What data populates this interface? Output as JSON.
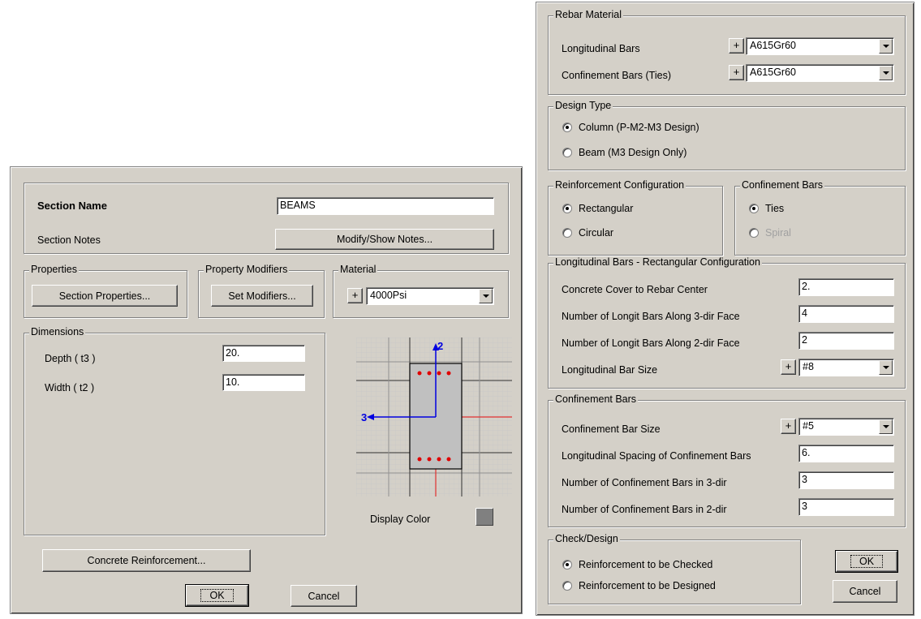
{
  "left": {
    "section_name_label": "Section Name",
    "section_name_value": "BEAMS",
    "section_notes_label": "Section Notes",
    "modify_notes_button": "Modify/Show Notes...",
    "properties_legend": "Properties",
    "section_properties_button": "Section Properties...",
    "modifiers_legend": "Property Modifiers",
    "set_modifiers_button": "Set Modifiers...",
    "material_legend": "Material",
    "material_plus": "+",
    "material_value": "4000Psi",
    "dimensions_legend": "Dimensions",
    "depth_label": "Depth  ( t3 )",
    "depth_value": "20.",
    "width_label": "Width  ( t2 )",
    "width_value": "10.",
    "axis_2_label": "2",
    "axis_3_label": "3",
    "display_color_label": "Display Color",
    "display_color": "#808080",
    "concrete_reinforcement_button": "Concrete Reinforcement...",
    "ok_button": "OK",
    "cancel_button": "Cancel"
  },
  "right": {
    "rebar_material_legend": "Rebar Material",
    "longitudinal_bars_label": "Longitudinal Bars",
    "longitudinal_bars_plus": "+",
    "longitudinal_bars_value": "A615Gr60",
    "confinement_ties_label": "Confinement Bars  (Ties)",
    "confinement_ties_plus": "+",
    "confinement_ties_value": "A615Gr60",
    "design_type_legend": "Design Type",
    "design_column_label": "Column  (P-M2-M3 Design)",
    "design_beam_label": "Beam  (M3 Design Only)",
    "reinf_config_legend": "Reinforcement Configuration",
    "config_rect_label": "Rectangular",
    "config_circ_label": "Circular",
    "confinement_legend": "Confinement Bars",
    "ties_label": "Ties",
    "spiral_label": "Spiral",
    "long_rect_legend": "Longitudinal Bars - Rectangular Configuration",
    "cover_label": "Concrete Cover to Rebar Center",
    "cover_value": "2.",
    "bars_3dir_label": "Number of Longit Bars Along 3-dir Face",
    "bars_3dir_value": "4",
    "bars_2dir_label": "Number of Longit Bars Along 2-dir Face",
    "bars_2dir_value": "2",
    "long_bar_size_label": "Longitudinal Bar Size",
    "long_bar_size_plus": "+",
    "long_bar_size_value": "#8",
    "conf_bars_legend": "Confinement Bars",
    "conf_bar_size_label": "Confinement Bar Size",
    "conf_bar_size_plus": "+",
    "conf_bar_size_value": "#5",
    "conf_spacing_label": "Longitudinal Spacing of Confinement Bars",
    "conf_spacing_value": "6.",
    "conf_3dir_label": "Number of Confinement Bars in 3-dir",
    "conf_3dir_value": "3",
    "conf_2dir_label": "Number of Confinement Bars in 2-dir",
    "conf_2dir_value": "3",
    "check_design_legend": "Check/Design",
    "checked_label": "Reinforcement to be Checked",
    "designed_label": "Reinforcement to be Designed",
    "ok_button": "OK",
    "cancel_button": "Cancel"
  }
}
